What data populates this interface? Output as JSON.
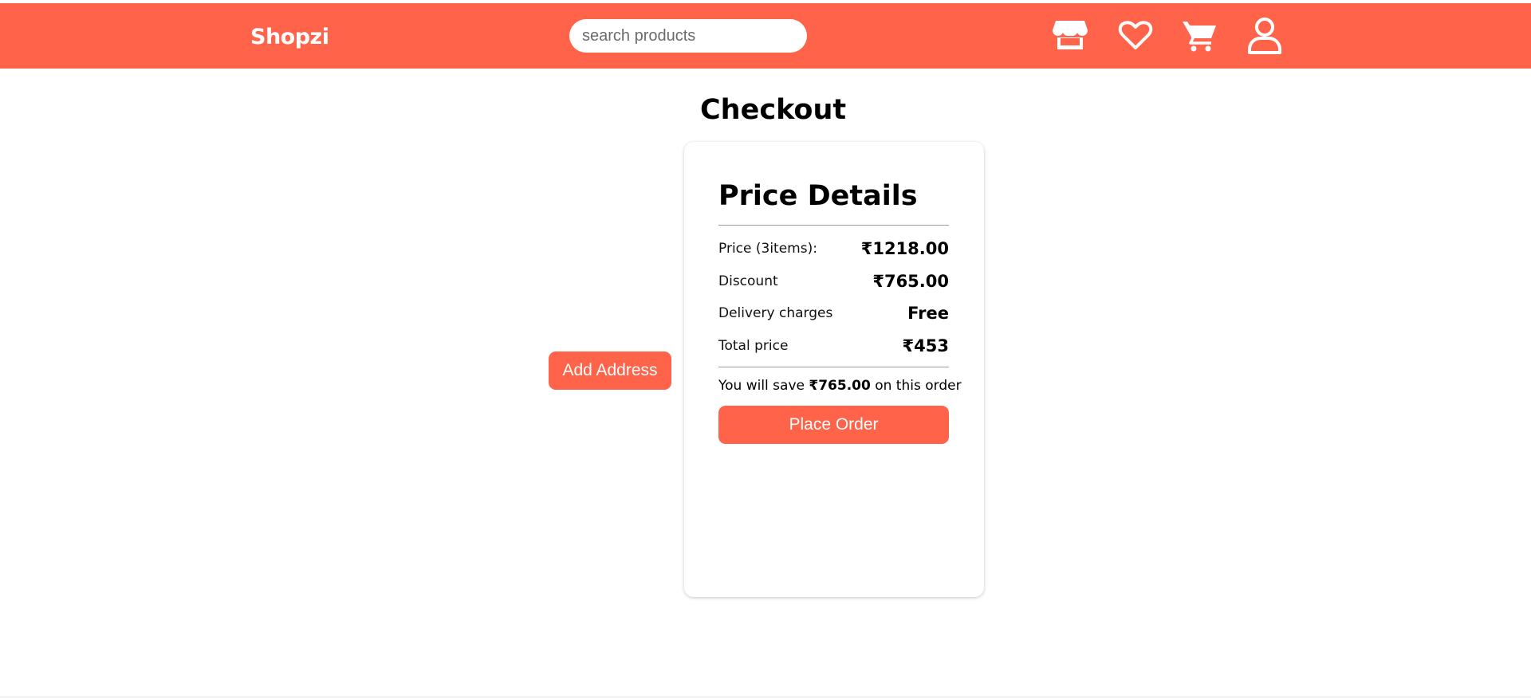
{
  "header": {
    "brand": "Shopzi",
    "search_placeholder": "search products",
    "icons": [
      "store-icon",
      "heart-icon",
      "cart-icon",
      "user-icon"
    ]
  },
  "page": {
    "title": "Checkout",
    "add_address_label": "Add Address"
  },
  "price_details": {
    "title": "Price Details",
    "rows": [
      {
        "label": "Price (3items):",
        "value": "₹1218.00"
      },
      {
        "label": "Discount",
        "value": "₹765.00"
      },
      {
        "label": "Delivery charges",
        "value": "Free"
      },
      {
        "label": "Total price",
        "value": "₹453"
      }
    ],
    "save_prefix": "You will save ",
    "save_amount": "₹765.00",
    "save_suffix": " on this order",
    "place_order_label": "Place Order"
  },
  "colors": {
    "accent": "#ff6349",
    "background": "#ffffff",
    "text": "#000000"
  }
}
